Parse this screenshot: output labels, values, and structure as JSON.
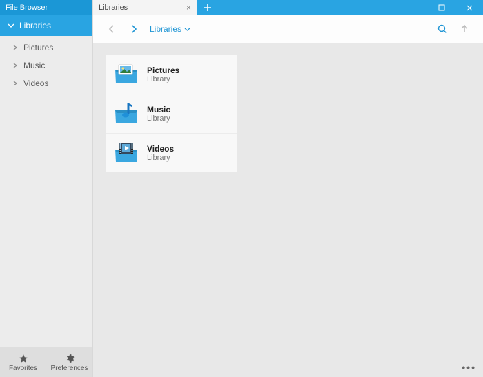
{
  "app": {
    "title": "File Browser"
  },
  "sidebar": {
    "active": {
      "label": "Libraries"
    },
    "items": [
      {
        "label": "Pictures"
      },
      {
        "label": "Music"
      },
      {
        "label": "Videos"
      }
    ],
    "bottom": {
      "favorites": "Favorites",
      "preferences": "Preferences"
    }
  },
  "tabs": {
    "active": {
      "label": "Libraries"
    }
  },
  "toolbar": {
    "breadcrumb": "Libraries"
  },
  "content": {
    "items": [
      {
        "name": "Pictures",
        "type": "Library"
      },
      {
        "name": "Music",
        "type": "Library"
      },
      {
        "name": "Videos",
        "type": "Library"
      }
    ]
  }
}
